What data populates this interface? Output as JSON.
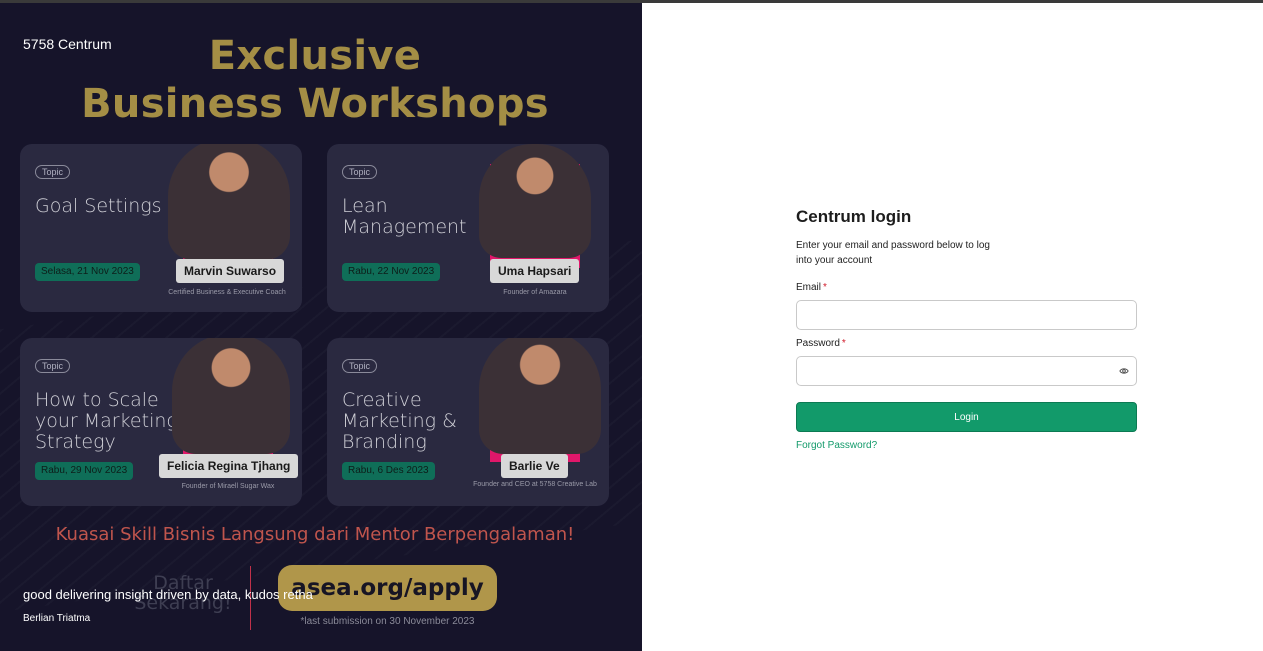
{
  "promo": {
    "brand": "5758 Centrum",
    "headline_line1": "Exclusive",
    "headline_line2": "Business Workshops",
    "cards": [
      {
        "topic": "Topic",
        "title": "Goal Settings",
        "date": "Selasa, 21 Nov 2023",
        "speaker": "Marvin Suwarso",
        "role": "Certified Business & Executive Coach"
      },
      {
        "topic": "Topic",
        "title": "Lean Management",
        "date": "Rabu, 22 Nov 2023",
        "speaker": "Uma Hapsari",
        "role": "Founder of Amazara"
      },
      {
        "topic": "Topic",
        "title": "How to Scale your Marketing Strategy",
        "date": "Rabu, 29 Nov 2023",
        "speaker": "Felicia Regina Tjhang",
        "role": "Founder of Miraell Sugar Wax"
      },
      {
        "topic": "Topic",
        "title": "Creative Marketing & Branding",
        "date": "Rabu, 6 Des 2023",
        "speaker": "Barlie Ve",
        "role": "Founder and CEO at 5758 Creative Lab"
      }
    ],
    "subtitle": "Kuasai Skill Bisnis Langsung dari Mentor Berpengalaman!",
    "cta_left": "Daftar Sekarang!",
    "cta_url": "asea.org/apply",
    "last_submission": "*last submission on 30 November 2023",
    "testimonial": "good delivering insight driven by data, kudos retha",
    "testimonial_author": "Berlian Triatma"
  },
  "login": {
    "title": "Centrum login",
    "description": "Enter your email and password below to log into your account",
    "email_label": "Email",
    "email_value": "",
    "password_label": "Password",
    "password_value": "",
    "required_mark": "*",
    "login_button": "Login",
    "forgot_password": "Forgot Password?",
    "accent_color": "#129a6a",
    "required_color": "#d11a2a"
  },
  "icons": {
    "password_toggle": "eye-icon"
  }
}
